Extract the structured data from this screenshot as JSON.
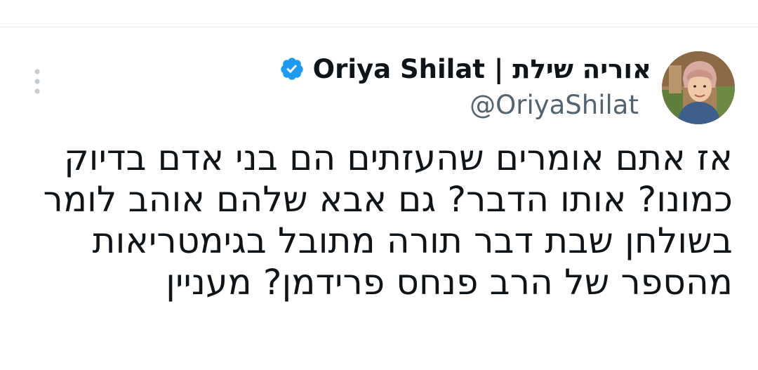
{
  "tweet": {
    "author": {
      "display_name": "אוריה שילת | Oriya Shilat",
      "handle": "@OriyaShilat",
      "verified": true,
      "verified_icon": "verified-badge-icon",
      "avatar_icon": "profile-photo"
    },
    "more_icon": "vertical-ellipsis-icon",
    "text_lines": [
      "אז אתם אומרים שהעזתים הם בני אדם בדיוק",
      "כמונו? אותו הדבר? גם אבא שלהם אוהב לומר",
      "בשולחן שבת דבר תורה מתובל בגימטריאות",
      "מהספר של הרב פנחס פרידמן? מעניין"
    ]
  },
  "colors": {
    "text_primary": "#0f1419",
    "text_secondary": "#536471",
    "verified_blue": "#1d9bf0",
    "divider": "#e6e9eb",
    "more_icon": "#c5ccd2"
  }
}
